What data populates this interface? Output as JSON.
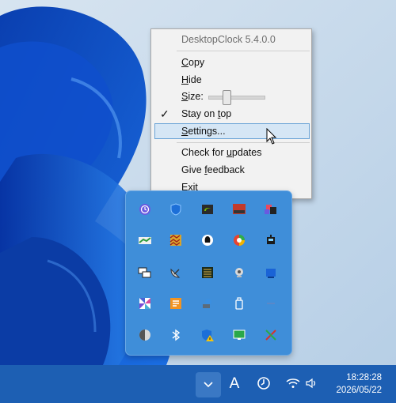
{
  "menu": {
    "title": "DesktopClock 5.4.0.0",
    "items": {
      "copy": {
        "pre": "",
        "ul": "C",
        "post": "opy"
      },
      "hide": {
        "pre": "",
        "ul": "H",
        "post": "ide"
      },
      "size": {
        "pre": "",
        "ul": "S",
        "post": "ize:"
      },
      "stay_on_top": {
        "pre": "Stay on ",
        "ul": "t",
        "post": "op"
      },
      "settings": {
        "pre": "",
        "ul": "S",
        "post": "ettings..."
      },
      "check_updates": {
        "pre": "Check for ",
        "ul": "u",
        "post": "pdates"
      },
      "feedback": {
        "pre": "Give ",
        "ul": "f",
        "post": "eedback"
      },
      "exit": {
        "pre": "",
        "ul": "E",
        "post": "xit"
      }
    },
    "stay_on_top_checked": true,
    "check_glyph": "✓",
    "size_slider_level": 0.3,
    "highlighted": "settings"
  },
  "tray_icons": [
    [
      "clock-app-icon",
      "defender-shield-icon",
      "nvidia-icon",
      "monitor-app-icon",
      "store-app-icon"
    ],
    [
      "chart-app-icon",
      "pattern-app-icon",
      "penguin-app-icon",
      "colorful-circle-icon",
      "robot-app-icon"
    ],
    [
      "windows-app-icon",
      "satellite-dish-icon",
      "display-grid-icon",
      "webcam-icon",
      "blue-square-icon"
    ],
    [
      "pinwheel-icon",
      "notes-app-icon",
      "network-share-icon",
      "usb-drive-icon",
      "blank-icon"
    ],
    [
      "half-circle-icon",
      "bluetooth-icon",
      "shield-warning-icon",
      "network-monitor-icon",
      "snipping-icon"
    ]
  ],
  "taskbar": {
    "chevron_glyph": "⌄",
    "ime_label": "A",
    "time": "18:28:28",
    "date": "2026/05/22"
  },
  "colors": {
    "taskbar": "#1d5fb3",
    "flyout": "#3f8ed9",
    "menu_bg": "#f2f2f2",
    "menu_highlight": "#d5e6f5"
  }
}
